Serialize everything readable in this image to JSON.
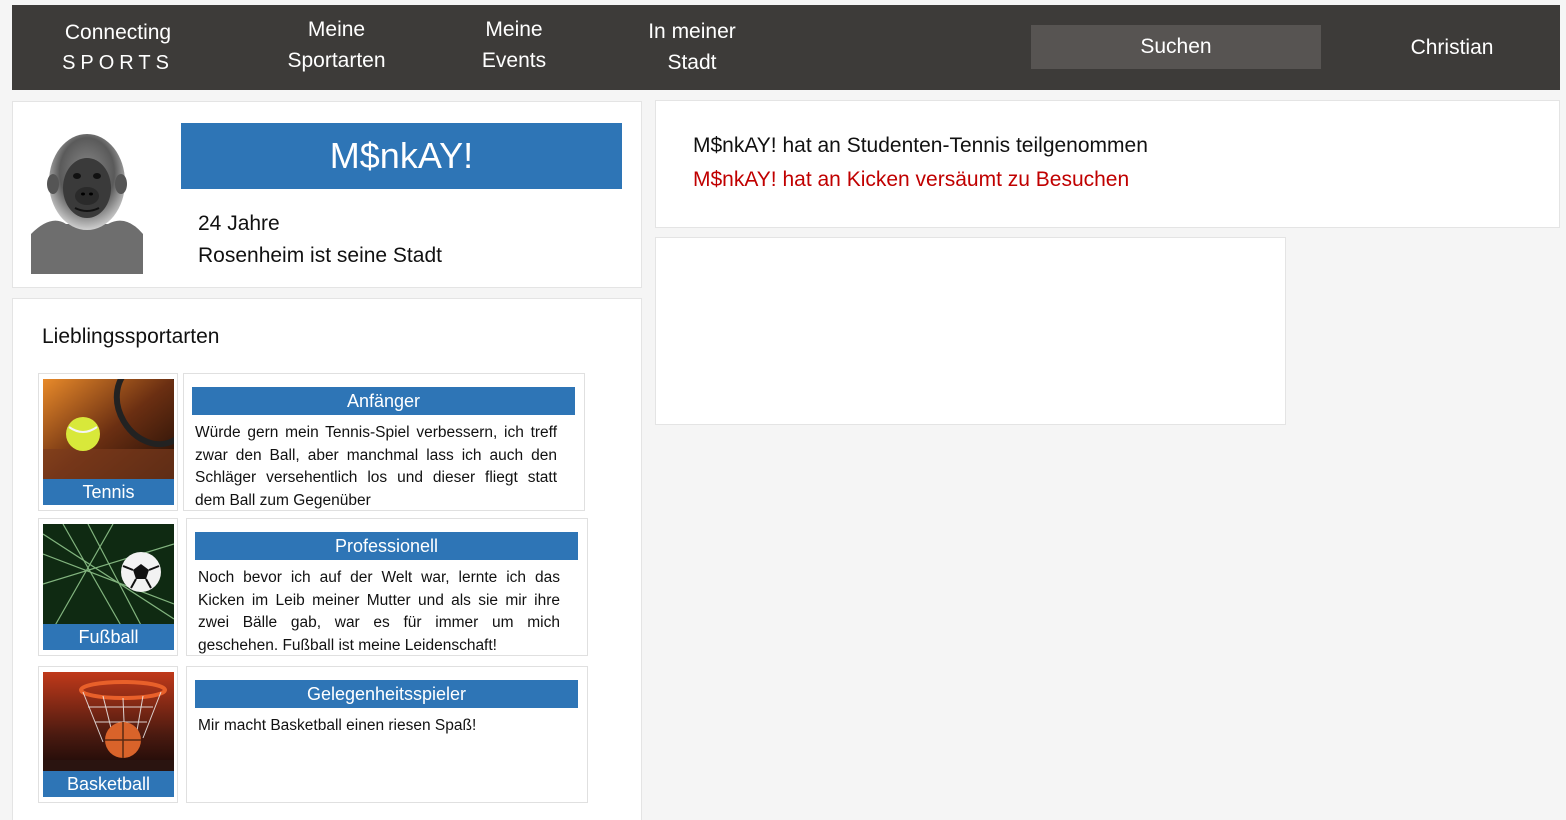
{
  "nav": {
    "brand_line1": "Connecting",
    "brand_line2": "SPORTS",
    "my_sports_line1": "Meine",
    "my_sports_line2": "Sportarten",
    "my_events_line1": "Meine",
    "my_events_line2": "Events",
    "city_line1": "In meiner",
    "city_line2": "Stadt",
    "search_label": "Suchen",
    "user_name": "Christian"
  },
  "profile": {
    "name": "M$nkAY!",
    "age": "24 Jahre",
    "city": "Rosenheim ist seine Stadt",
    "avatar_icon": "ape-portrait-icon"
  },
  "favorites": {
    "title": "Lieblingssportarten",
    "items": [
      {
        "sport": "Tennis",
        "level": "Anfänger",
        "description": "Würde gern mein Tennis-Spiel verbessern, ich treff zwar den Ball, aber manchmal lass ich auch den Schläger versehentlich los und dieser fliegt statt dem Ball zum Gegenüber",
        "icon": "tennis-ball-icon"
      },
      {
        "sport": "Fußball",
        "level": "Professionell",
        "description": "Noch bevor ich auf der Welt war, lernte ich das Kicken im Leib meiner Mutter und als sie mir ihre zwei Bälle gab, war es für immer um mich geschehen. Fußball ist meine Leidenschaft!",
        "icon": "soccer-ball-icon"
      },
      {
        "sport": "Basketball",
        "level": "Gelegenheitsspieler",
        "description": "Mir macht Basketball einen riesen Spaß!",
        "icon": "basketball-icon"
      }
    ]
  },
  "activity": {
    "line1": "M$nkAY! hat an Studenten-Tennis teilgenommen",
    "line2": "M$nkAY! hat an Kicken versäumt zu Besuchen"
  },
  "colors": {
    "nav_bg": "#3d3b39",
    "accent": "#2e75b6",
    "missed": "#c00000"
  }
}
